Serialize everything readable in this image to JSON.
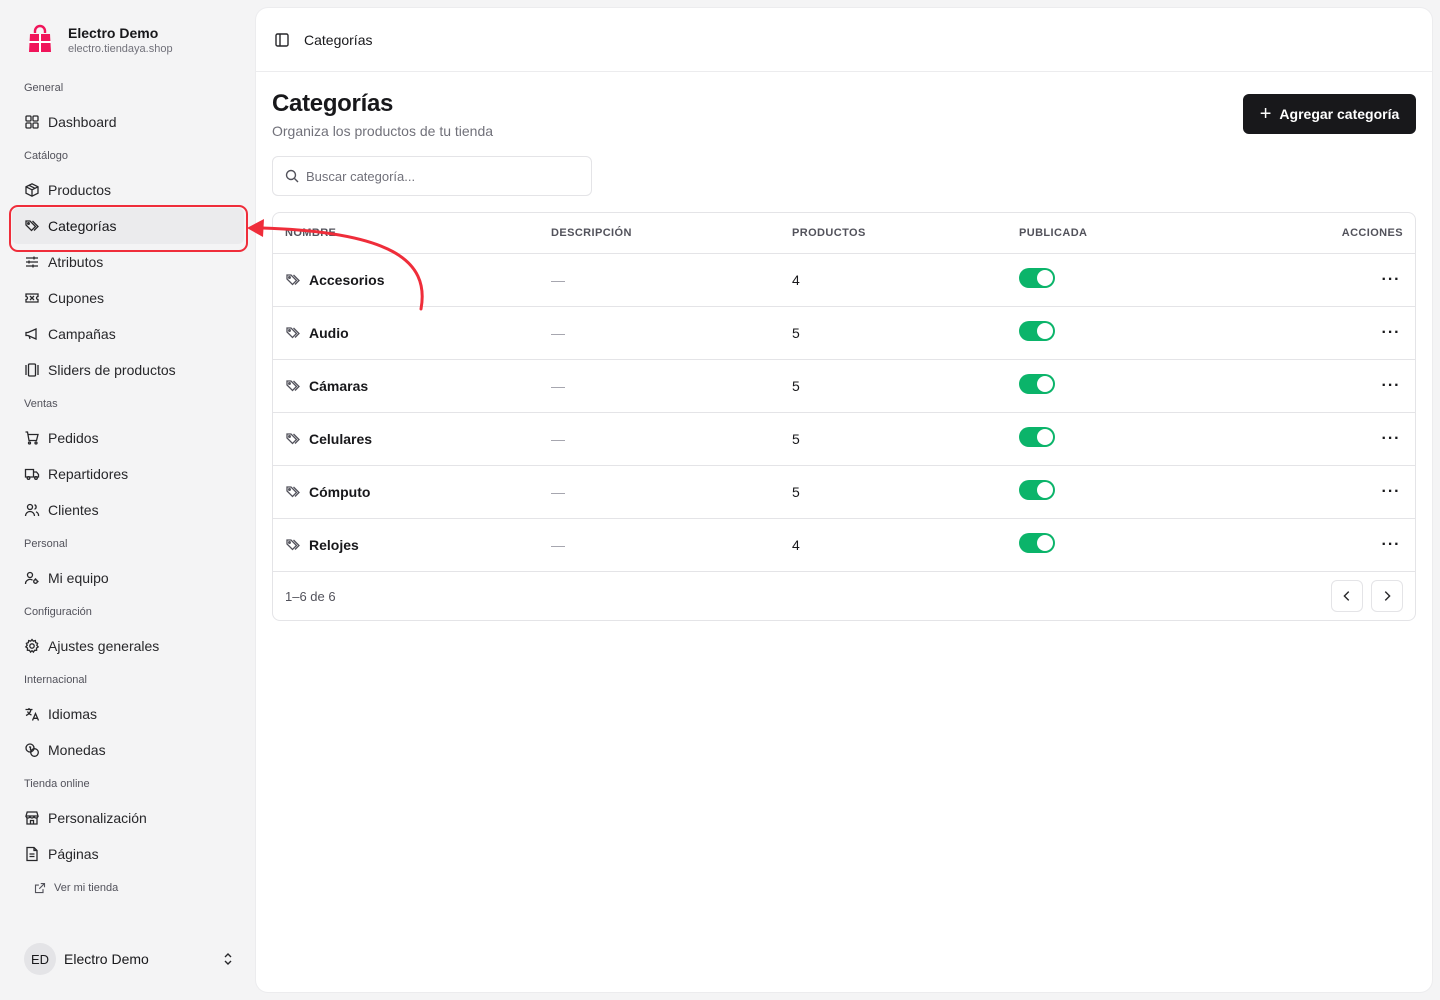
{
  "brand": {
    "name": "Electro Demo",
    "url": "electro.tiendaya.shop"
  },
  "sidebar": {
    "sections": [
      {
        "label": "General",
        "items": [
          {
            "label": "Dashboard",
            "icon": "grid-icon"
          }
        ]
      },
      {
        "label": "Catálogo",
        "items": [
          {
            "label": "Productos",
            "icon": "box-icon"
          },
          {
            "label": "Categorías",
            "icon": "tag-icon",
            "active": true
          },
          {
            "label": "Atributos",
            "icon": "sliders-icon"
          },
          {
            "label": "Cupones",
            "icon": "ticket-icon"
          },
          {
            "label": "Campañas",
            "icon": "megaphone-icon"
          },
          {
            "label": "Sliders de productos",
            "icon": "carousel-icon"
          }
        ]
      },
      {
        "label": "Ventas",
        "items": [
          {
            "label": "Pedidos",
            "icon": "cart-icon"
          },
          {
            "label": "Repartidores",
            "icon": "truck-icon"
          },
          {
            "label": "Clientes",
            "icon": "users-icon"
          }
        ]
      },
      {
        "label": "Personal",
        "items": [
          {
            "label": "Mi equipo",
            "icon": "user-key-icon"
          }
        ]
      },
      {
        "label": "Configuración",
        "items": [
          {
            "label": "Ajustes generales",
            "icon": "gear-icon"
          }
        ]
      },
      {
        "label": "Internacional",
        "items": [
          {
            "label": "Idiomas",
            "icon": "translate-icon"
          },
          {
            "label": "Monedas",
            "icon": "coins-icon"
          }
        ]
      },
      {
        "label": "Tienda online",
        "items": [
          {
            "label": "Personalización",
            "icon": "store-icon"
          },
          {
            "label": "Páginas",
            "icon": "file-icon"
          }
        ]
      }
    ],
    "view_store": "Ver mi tienda",
    "user": {
      "initials": "ED",
      "name": "Electro Demo"
    }
  },
  "topbar": {
    "breadcrumb": "Categorías"
  },
  "page": {
    "title": "Categorías",
    "subtitle": "Organiza los productos de tu tienda",
    "add_button": "Agregar categoría",
    "search_placeholder": "Buscar categoría..."
  },
  "table": {
    "columns": [
      "NOMBRE",
      "DESCRIPCIÓN",
      "PRODUCTOS",
      "PUBLICADA",
      "ACCIONES"
    ],
    "rows": [
      {
        "name": "Accesorios",
        "description": "—",
        "products": "4",
        "published": true
      },
      {
        "name": "Audio",
        "description": "—",
        "products": "5",
        "published": true
      },
      {
        "name": "Cámaras",
        "description": "—",
        "products": "5",
        "published": true
      },
      {
        "name": "Celulares",
        "description": "—",
        "products": "5",
        "published": true
      },
      {
        "name": "Cómputo",
        "description": "—",
        "products": "5",
        "published": true
      },
      {
        "name": "Relojes",
        "description": "—",
        "products": "4",
        "published": true
      }
    ],
    "pagination": "1–6 de 6"
  },
  "colors": {
    "accent_toggle": "#0bb46a",
    "primary_button": "#18181b",
    "annotation": "#ef2d3a",
    "brand": "#f0145a"
  }
}
